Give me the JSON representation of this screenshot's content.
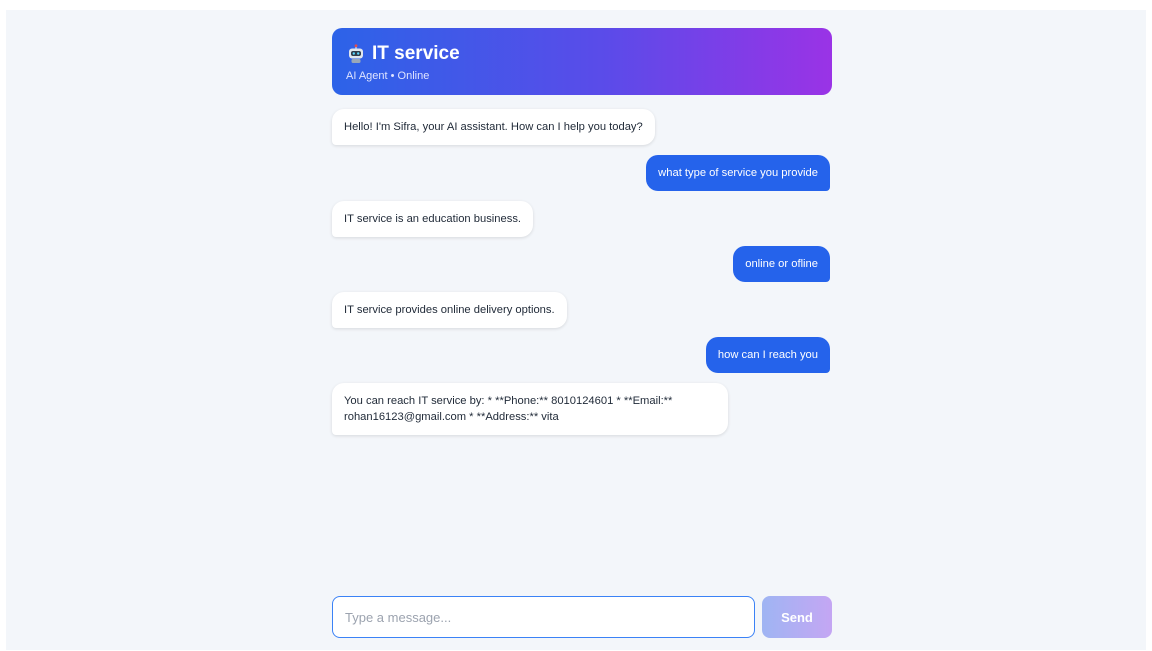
{
  "header": {
    "title": "IT service",
    "subtitle": "AI Agent • Online",
    "icon": "robot-icon"
  },
  "messages": [
    {
      "sender": "bot",
      "text": "Hello! I'm Sifra, your AI assistant. How can I help you today?"
    },
    {
      "sender": "user",
      "text": "what type of service you provide"
    },
    {
      "sender": "bot",
      "text": "IT service is an education business."
    },
    {
      "sender": "user",
      "text": "online or ofline"
    },
    {
      "sender": "bot",
      "text": "IT service provides online delivery options."
    },
    {
      "sender": "user",
      "text": "how can I reach you"
    },
    {
      "sender": "bot",
      "text": "You can reach IT service by: * **Phone:** 8010124601 * **Email:** rohan16123@gmail.com * **Address:** vita"
    }
  ],
  "composer": {
    "placeholder": "Type a message...",
    "value": "",
    "send_label": "Send"
  },
  "colors": {
    "header_gradient_start": "#2c63e8",
    "header_gradient_end": "#9a33e6",
    "user_bubble": "#2563eb",
    "bot_bubble": "#ffffff",
    "background": "#f3f6fa"
  }
}
